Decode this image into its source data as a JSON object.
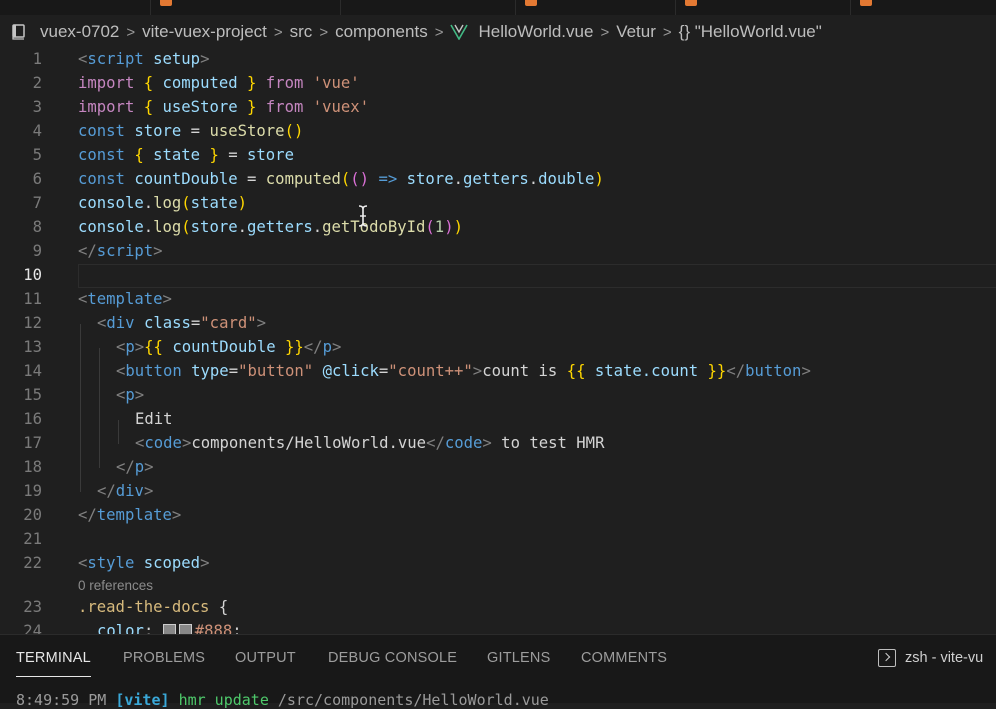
{
  "breadcrumb": {
    "items": [
      "vuex-0702",
      "vite-vuex-project",
      "src",
      "components",
      "HelloWorld.vue",
      "Vetur",
      "{} \"HelloWorld.vue\""
    ]
  },
  "editor": {
    "active_line": 10,
    "code_lens_references": "0 references",
    "line_numbers": [
      "1",
      "2",
      "3",
      "4",
      "5",
      "6",
      "7",
      "8",
      "9",
      "10",
      "11",
      "12",
      "13",
      "14",
      "15",
      "16",
      "17",
      "18",
      "19",
      "20",
      "21",
      "22",
      "23",
      "24"
    ],
    "lines": {
      "l1": [
        "<",
        "script",
        " setup",
        ">"
      ],
      "l2": [
        "import",
        " ",
        "{",
        " computed ",
        "}",
        " from ",
        "'vue'"
      ],
      "l3": [
        "import",
        " ",
        "{",
        " useStore ",
        "}",
        " from ",
        "'vuex'"
      ],
      "l4": [
        "const",
        " store ",
        "=",
        " useStore",
        "()"
      ],
      "l5": [
        "const",
        " ",
        "{",
        " state ",
        "}",
        " = ",
        "store"
      ],
      "l6": [
        "const",
        " countDouble ",
        "=",
        " computed",
        "(",
        "()",
        " => ",
        "store",
        ".",
        "getters",
        ".",
        "double",
        ")"
      ],
      "l7": [
        "console",
        ".",
        "log",
        "(",
        "state",
        ")"
      ],
      "l8": [
        "console",
        ".",
        "log",
        "(",
        "store",
        ".",
        "getters",
        ".",
        "getTodoById",
        "(",
        "1",
        ")",
        ")"
      ],
      "l9": [
        "</",
        "script",
        ">"
      ],
      "l11": [
        "<",
        "template",
        ">"
      ],
      "l12": [
        "<",
        "div",
        " class",
        "=",
        "\"card\"",
        ">"
      ],
      "l13": [
        "<",
        "p",
        ">",
        "{{",
        " countDouble ",
        "}}",
        "</",
        "p",
        ">"
      ],
      "l14": [
        "<",
        "button",
        " type",
        "=",
        "\"button\"",
        " @click",
        "=",
        "\"count++\"",
        ">",
        "count is ",
        "{{",
        " state.count ",
        "}}",
        "</",
        "button",
        ">"
      ],
      "l15": [
        "<",
        "p",
        ">"
      ],
      "l16": [
        "Edit"
      ],
      "l17": [
        "<",
        "code",
        ">",
        "components/HelloWorld.vue",
        "</",
        "code",
        ">",
        " to test HMR"
      ],
      "l18": [
        "</",
        "p",
        ">"
      ],
      "l19": [
        "</",
        "div",
        ">"
      ],
      "l20": [
        "</",
        "template",
        ">"
      ],
      "l22": [
        "<",
        "style",
        " scoped",
        ">"
      ],
      "l23": [
        ".read-the-docs",
        " {"
      ],
      "l24": [
        "color",
        ": ",
        "#888",
        ";"
      ]
    }
  },
  "panel": {
    "tabs": [
      "TERMINAL",
      "PROBLEMS",
      "OUTPUT",
      "DEBUG CONSOLE",
      "GITLENS",
      "COMMENTS"
    ],
    "active_tab": "TERMINAL",
    "terminal_selector": "zsh - vite-vu",
    "terminal_line": {
      "time": "8:49:59 PM",
      "tag": "[vite]",
      "event": "hmr update",
      "path": "/src/components/HelloWorld.vue"
    }
  },
  "colors": {
    "editor_bg": "#1f1f1f",
    "tag": "#569cd6",
    "attribute": "#9cdcfe",
    "string": "#ce9178",
    "keyword": "#c586c0",
    "function": "#dcdcaa",
    "bracket": "#ffd700"
  },
  "icons": {
    "breadcrumb_file": "book-icon",
    "vue_file": "vue-logo-icon",
    "terminal": "terminal-icon"
  }
}
